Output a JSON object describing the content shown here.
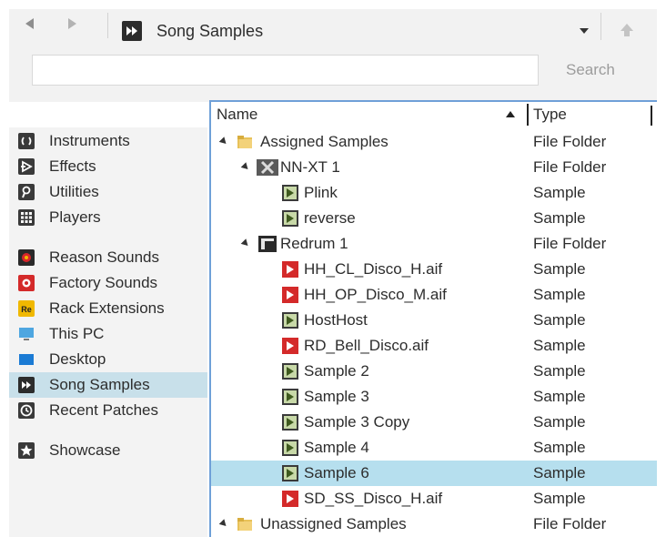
{
  "nav": {
    "back_icon": "back-arrow-icon",
    "forward_icon": "forward-arrow-icon",
    "location_icon": "song-samples-icon",
    "location": "Song Samples",
    "up_icon": "up-arrow-icon"
  },
  "search": {
    "value": "",
    "placeholder": "",
    "label": "Search"
  },
  "sidebar": {
    "items": [
      {
        "label": "Instruments",
        "icon": "instruments-icon"
      },
      {
        "label": "Effects",
        "icon": "effects-icon"
      },
      {
        "label": "Utilities",
        "icon": "utilities-icon"
      },
      {
        "label": "Players",
        "icon": "players-icon"
      },
      {
        "label": "Reason Sounds",
        "icon": "reason-sounds-icon"
      },
      {
        "label": "Factory Sounds",
        "icon": "factory-sounds-icon"
      },
      {
        "label": "Rack Extensions",
        "icon": "rack-extensions-icon"
      },
      {
        "label": "This PC",
        "icon": "this-pc-icon"
      },
      {
        "label": "Desktop",
        "icon": "desktop-icon"
      },
      {
        "label": "Song Samples",
        "icon": "song-samples-icon",
        "selected": true
      },
      {
        "label": "Recent Patches",
        "icon": "recent-patches-icon"
      },
      {
        "label": "Showcase",
        "icon": "star-icon"
      }
    ]
  },
  "list": {
    "columns": {
      "name": "Name",
      "type": "Type"
    },
    "rows": [
      {
        "name": "Assigned Samples",
        "type": "File Folder",
        "icon": "folder-icon"
      },
      {
        "name": "NN-XT 1",
        "type": "File Folder",
        "icon": "nn-xt-icon"
      },
      {
        "name": "Plink",
        "type": "Sample",
        "icon": "sample-icon"
      },
      {
        "name": "reverse",
        "type": "Sample",
        "icon": "sample-icon"
      },
      {
        "name": "Redrum 1",
        "type": "File Folder",
        "icon": "redrum-icon"
      },
      {
        "name": "HH_CL_Disco_H.aif",
        "type": "Sample",
        "icon": "factory-sample-icon"
      },
      {
        "name": "HH_OP_Disco_M.aif",
        "type": "Sample",
        "icon": "factory-sample-icon"
      },
      {
        "name": "HostHost",
        "type": "Sample",
        "icon": "sample-icon"
      },
      {
        "name": "RD_Bell_Disco.aif",
        "type": "Sample",
        "icon": "factory-sample-icon"
      },
      {
        "name": "Sample 2",
        "type": "Sample",
        "icon": "sample-icon"
      },
      {
        "name": "Sample 3",
        "type": "Sample",
        "icon": "sample-icon"
      },
      {
        "name": "Sample 3 Copy",
        "type": "Sample",
        "icon": "sample-icon"
      },
      {
        "name": "Sample 4",
        "type": "Sample",
        "icon": "sample-icon"
      },
      {
        "name": "Sample 6",
        "type": "Sample",
        "icon": "sample-icon",
        "selected": true
      },
      {
        "name": "SD_SS_Disco_H.aif",
        "type": "Sample",
        "icon": "factory-sample-icon"
      },
      {
        "name": "Unassigned Samples",
        "type": "File Folder",
        "icon": "folder-icon"
      }
    ]
  },
  "colors": {
    "selection": "#b6dfee",
    "sidebar_selection": "#c8e0ea",
    "panel_border": "#6fa0d8",
    "factory_red": "#d42a2a",
    "sample_green": "#8fbc3a",
    "folder_yellow": "#e8c25a"
  }
}
